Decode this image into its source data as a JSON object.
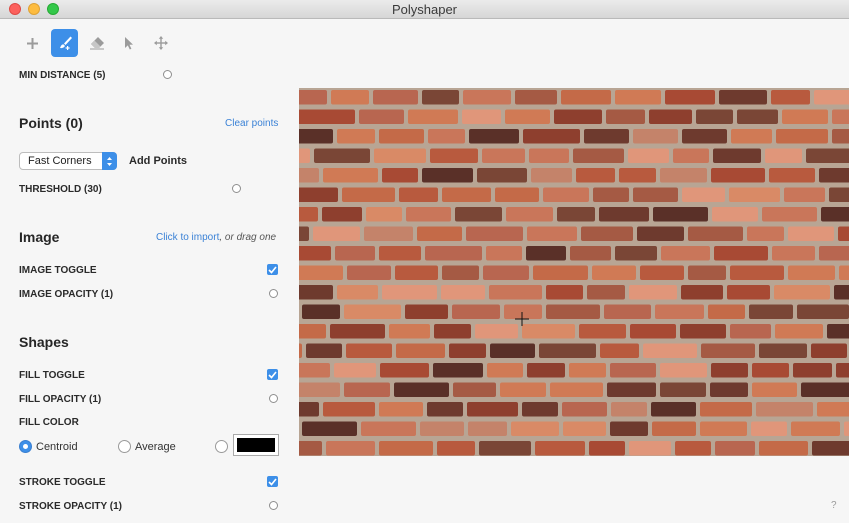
{
  "window": {
    "title": "Polyshaper"
  },
  "toolbar": {
    "tools": [
      {
        "name": "add-point-tool",
        "icon": "plus-icon",
        "active": false
      },
      {
        "name": "brush-tool",
        "icon": "brush-icon",
        "active": true
      },
      {
        "name": "eraser-tool",
        "icon": "eraser-icon",
        "active": false
      },
      {
        "name": "select-tool",
        "icon": "pointer-icon",
        "active": false
      },
      {
        "name": "move-tool",
        "icon": "move-icon",
        "active": false
      }
    ]
  },
  "settings": {
    "min_distance_label": "MIN DISTANCE (5)"
  },
  "points": {
    "heading": "Points (0)",
    "clear_label": "Clear points",
    "detector_selected": "Fast Corners",
    "add_points_label": "Add Points",
    "threshold_label": "THRESHOLD (30)"
  },
  "image": {
    "heading": "Image",
    "import_link": "Click to import",
    "import_suffix": ", or drag one",
    "toggle_label": "IMAGE TOGGLE",
    "toggle_checked": true,
    "opacity_label": "IMAGE OPACITY (1)"
  },
  "shapes": {
    "heading": "Shapes",
    "fill_toggle_label": "FILL TOGGLE",
    "fill_toggle_checked": true,
    "fill_opacity_label": "FILL OPACITY (1)",
    "fill_color_label": "FILL COLOR",
    "fill_options": [
      {
        "label": "Centroid",
        "selected": true
      },
      {
        "label": "Average",
        "selected": false
      }
    ],
    "custom_color": "#000000",
    "stroke_toggle_label": "STROKE TOGGLE",
    "stroke_toggle_checked": true,
    "stroke_opacity_label": "STROKE OPACITY (1)"
  },
  "help": {
    "label": "?"
  },
  "colors": {
    "accent": "#3d8fe8",
    "link": "#3b82d6"
  }
}
